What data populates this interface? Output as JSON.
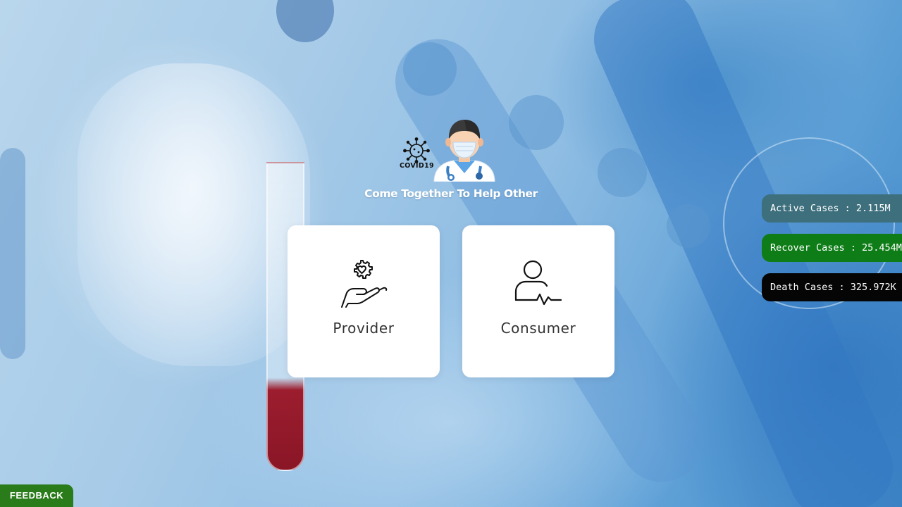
{
  "logo": {
    "virus_text": "COVID19"
  },
  "tagline": "Come Together To Help Other",
  "cards": {
    "provider": {
      "label": "Provider",
      "icon": "hand-heart-gear-icon"
    },
    "consumer": {
      "label": "Consumer",
      "icon": "person-pulse-icon"
    }
  },
  "stats": {
    "active": "Active Cases : 2.115M",
    "recover": "Recover Cases : 25.454M",
    "death": "Death Cases : 325.972K"
  },
  "feedback": "FEEDBACK",
  "colors": {
    "active": "#3d6f7c",
    "recover": "#0e7d17",
    "death": "#050505",
    "feedback": "#2a7b19"
  }
}
